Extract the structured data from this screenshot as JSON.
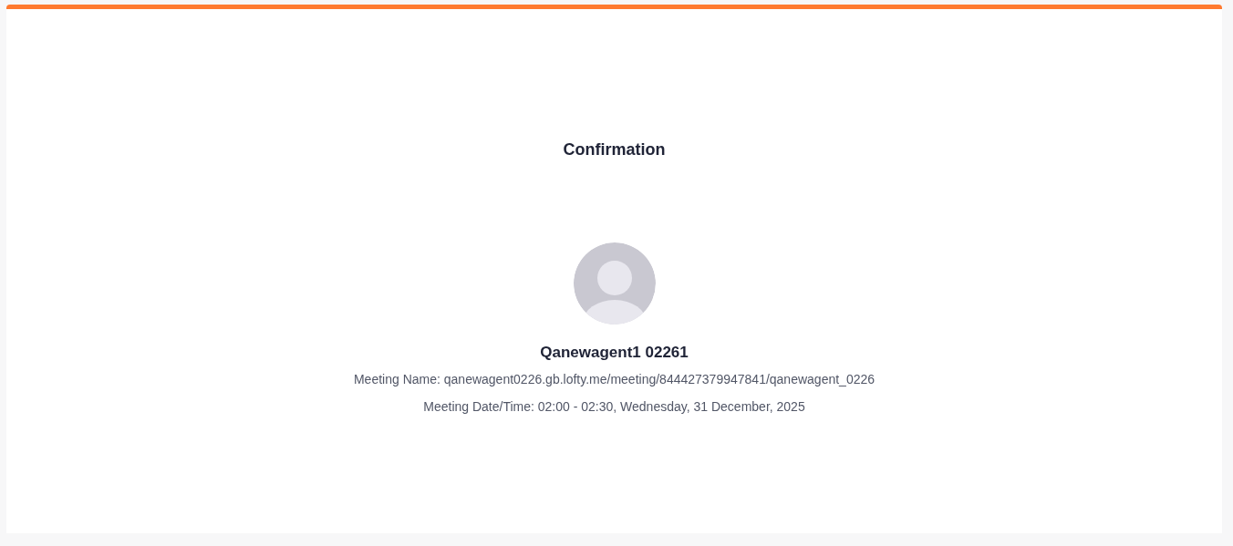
{
  "title": "Confirmation",
  "agent": {
    "name": "Qanewagent1 02261"
  },
  "details": [
    {
      "label": "Meeting Name:",
      "value": "qanewagent0226.gb.lofty.me/meeting/844427379947841/qanewagent_0226"
    },
    {
      "label": "Meeting Date/Time:",
      "value": "02:00 - 02:30, Wednesday, 31 December, 2025"
    }
  ]
}
